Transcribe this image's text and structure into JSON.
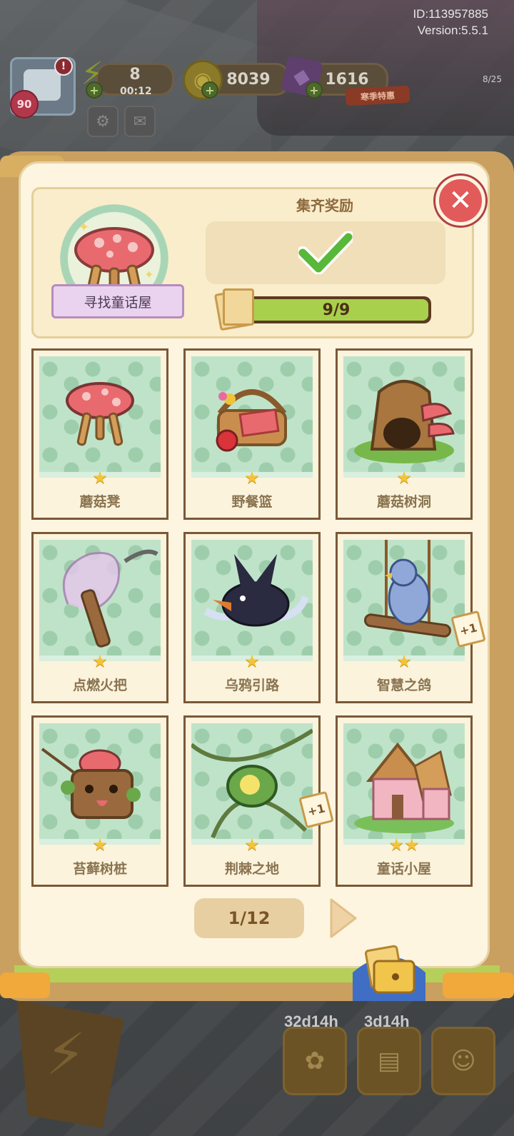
{
  "meta": {
    "id": "ID:113957885",
    "version": "Version:5.5.1"
  },
  "hud": {
    "level": "90",
    "alert": "!",
    "energy": "8",
    "energy_timer": "00:12",
    "coins": "8039",
    "gems": "1616",
    "event_tag": "寒季特惠",
    "event_count": "8/25"
  },
  "collection": {
    "emblem_label": "寻找童话屋",
    "reward_title": "集齐奖励",
    "progress_text": "9/9",
    "progress_fraction": 1.0,
    "cards": [
      {
        "name": "蘑菇凳",
        "stars": "★",
        "bonus": ""
      },
      {
        "name": "野餐篮",
        "stars": "★",
        "bonus": ""
      },
      {
        "name": "蘑菇树洞",
        "stars": "★",
        "bonus": ""
      },
      {
        "name": "点燃火把",
        "stars": "★",
        "bonus": ""
      },
      {
        "name": "乌鸦引路",
        "stars": "★",
        "bonus": ""
      },
      {
        "name": "智慧之鸽",
        "stars": "★",
        "bonus": "+1"
      },
      {
        "name": "苔藓树桩",
        "stars": "★",
        "bonus": ""
      },
      {
        "name": "荆棘之地",
        "stars": "★",
        "bonus": "+1"
      },
      {
        "name": "童话小屋",
        "stars": "★★",
        "bonus": ""
      }
    ],
    "page_indicator": "1/12"
  },
  "dock": {
    "timer1": "32d14h",
    "timer2": "3d14h"
  },
  "colors": {
    "accent_green": "#a8d04c",
    "close_red": "#e25a5a",
    "star": "#f5c338"
  }
}
